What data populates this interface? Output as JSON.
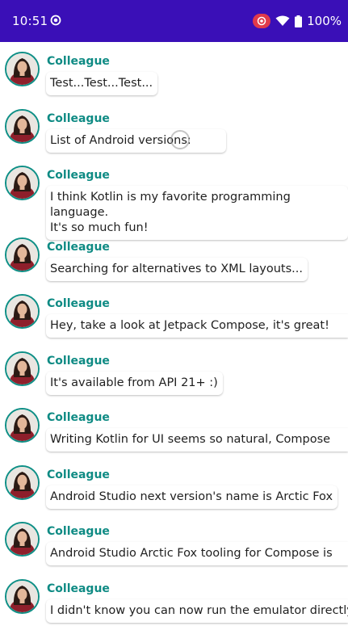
{
  "status_bar": {
    "time": "10:51",
    "battery": "100%",
    "background": "#3a0fb7"
  },
  "accent_color": "#0f8b84",
  "messages": [
    {
      "author": "Colleague",
      "body": "Test...Test...Test..."
    },
    {
      "author": "Colleague",
      "body": "List of Android versions:"
    },
    {
      "author": "Colleague",
      "body": "I think Kotlin is my favorite programming language.\nIt's so much fun!"
    },
    {
      "author": "Colleague",
      "body": "Searching for alternatives to XML layouts..."
    },
    {
      "author": "Colleague",
      "body": "Hey, take a look at Jetpack Compose, it's great!"
    },
    {
      "author": "Colleague",
      "body": "It's available from API 21+ :)"
    },
    {
      "author": "Colleague",
      "body": "Writing Kotlin for UI seems so natural, Compose"
    },
    {
      "author": "Colleague",
      "body": "Android Studio next version's name is Arctic Fox"
    },
    {
      "author": "Colleague",
      "body": "Android Studio Arctic Fox tooling for Compose is"
    },
    {
      "author": "Colleague",
      "body": "I didn't know you can now run the emulator directly"
    }
  ]
}
